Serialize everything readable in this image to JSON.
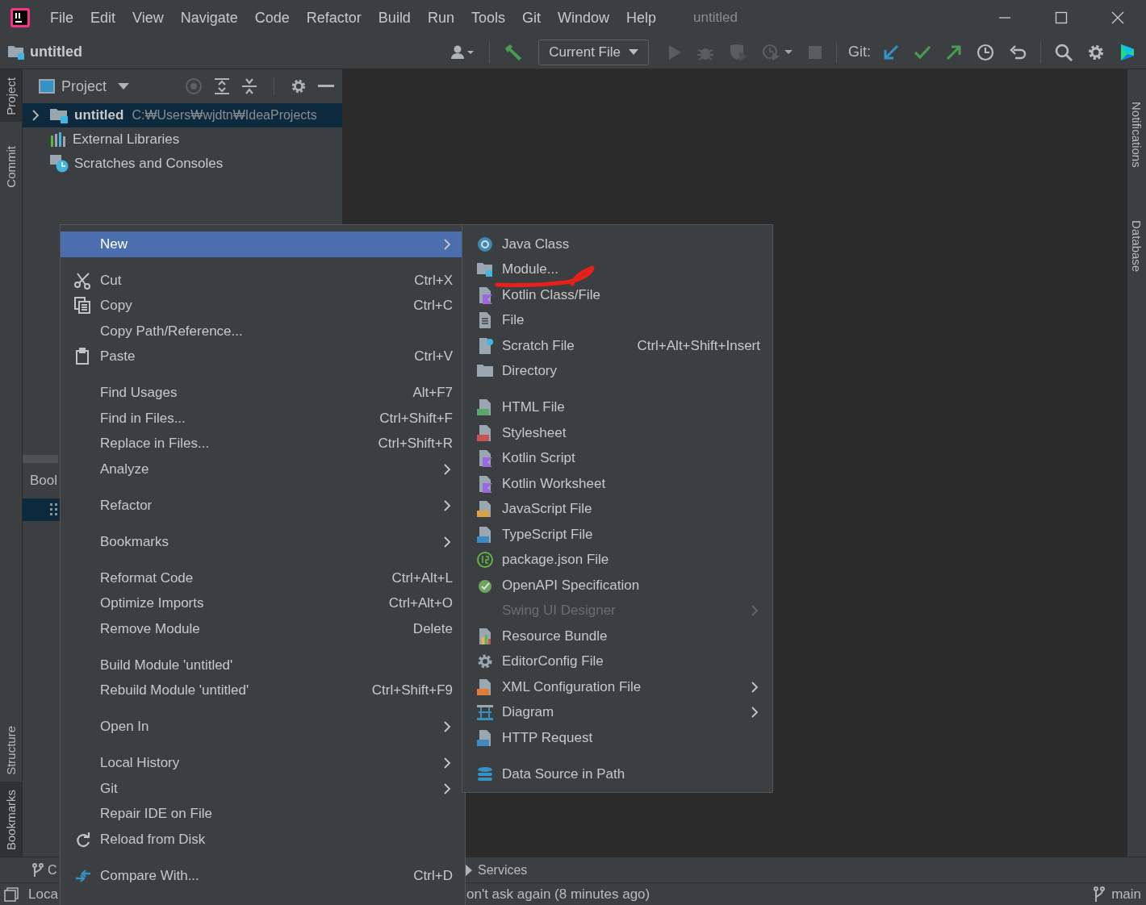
{
  "title_bar": {
    "menus": [
      {
        "label": "File"
      },
      {
        "label": "Edit"
      },
      {
        "label": "View"
      },
      {
        "label": "Navigate"
      },
      {
        "label": "Code"
      },
      {
        "label": "Refactor"
      },
      {
        "label": "Build"
      },
      {
        "label": "Run"
      },
      {
        "label": "Tools"
      },
      {
        "label": "Git"
      },
      {
        "label": "Window"
      },
      {
        "label": "Help"
      }
    ],
    "title": "untitled"
  },
  "toolbar": {
    "project": "untitled",
    "run_config": "Current File",
    "git_label": "Git:"
  },
  "left_stripe": {
    "top": [
      {
        "label": "Project",
        "selected": true
      },
      {
        "label": "Commit",
        "selected": false
      }
    ],
    "bottom": [
      {
        "label": "Structure",
        "selected": false
      },
      {
        "label": "Bookmarks",
        "selected": true
      }
    ]
  },
  "right_stripe": [
    {
      "label": "Notifications"
    },
    {
      "label": "Database"
    }
  ],
  "project_panel": {
    "title": "Project",
    "tree": [
      {
        "label": "untitled",
        "path": "C:₩Users₩wjdtn₩IdeaProjects",
        "expanded": false,
        "selected": true
      },
      {
        "label": "External Libraries",
        "selected": false
      },
      {
        "label": "Scratches and Consoles",
        "selected": false
      }
    ]
  },
  "bookmarks_panel": {
    "title": "Bool",
    "rows": [
      {
        "selected": true
      }
    ]
  },
  "bottom_bar": {
    "tabs": [
      {
        "label": "C"
      },
      {
        "label": "Services"
      }
    ]
  },
  "status_bar": {
    "left": "Loca",
    "message": "on't ask again (8 minutes ago)",
    "branch": "main"
  },
  "context_menu": {
    "items": [
      {
        "kind": "item",
        "label": "New",
        "submenu": true,
        "selected": true
      },
      {
        "kind": "separator"
      },
      {
        "kind": "item",
        "label": "Cut",
        "shortcut": "Ctrl+X",
        "selected": false
      },
      {
        "kind": "item",
        "label": "Copy",
        "shortcut": "Ctrl+C",
        "selected": false
      },
      {
        "kind": "item",
        "label": "Copy Path/Reference...",
        "selected": false
      },
      {
        "kind": "item",
        "label": "Paste",
        "shortcut": "Ctrl+V",
        "selected": false
      },
      {
        "kind": "separator"
      },
      {
        "kind": "item",
        "label": "Find Usages",
        "shortcut": "Alt+F7",
        "selected": false
      },
      {
        "kind": "item",
        "label": "Find in Files...",
        "shortcut": "Ctrl+Shift+F",
        "selected": false
      },
      {
        "kind": "item",
        "label": "Replace in Files...",
        "shortcut": "Ctrl+Shift+R",
        "selected": false
      },
      {
        "kind": "item",
        "label": "Analyze",
        "submenu": true,
        "selected": false
      },
      {
        "kind": "separator"
      },
      {
        "kind": "item",
        "label": "Refactor",
        "submenu": true,
        "selected": false
      },
      {
        "kind": "separator"
      },
      {
        "kind": "item",
        "label": "Bookmarks",
        "submenu": true,
        "selected": false
      },
      {
        "kind": "separator"
      },
      {
        "kind": "item",
        "label": "Reformat Code",
        "shortcut": "Ctrl+Alt+L",
        "selected": false
      },
      {
        "kind": "item",
        "label": "Optimize Imports",
        "shortcut": "Ctrl+Alt+O",
        "selected": false
      },
      {
        "kind": "item",
        "label": "Remove Module",
        "shortcut": "Delete",
        "selected": false
      },
      {
        "kind": "separator"
      },
      {
        "kind": "item",
        "label": "Build Module 'untitled'",
        "selected": false
      },
      {
        "kind": "item",
        "label": "Rebuild Module 'untitled'",
        "shortcut": "Ctrl+Shift+F9",
        "selected": false
      },
      {
        "kind": "separator"
      },
      {
        "kind": "item",
        "label": "Open In",
        "submenu": true,
        "selected": false
      },
      {
        "kind": "separator"
      },
      {
        "kind": "item",
        "label": "Local History",
        "submenu": true,
        "selected": false
      },
      {
        "kind": "item",
        "label": "Git",
        "submenu": true,
        "selected": false
      },
      {
        "kind": "item",
        "label": "Repair IDE on File",
        "selected": false
      },
      {
        "kind": "item",
        "label": "Reload from Disk",
        "selected": false
      },
      {
        "kind": "separator"
      },
      {
        "kind": "item",
        "label": "Compare With...",
        "shortcut": "Ctrl+D",
        "selected": false
      },
      {
        "kind": "separator"
      }
    ]
  },
  "submenu": {
    "items": [
      {
        "kind": "item",
        "label": "Java Class",
        "disabled": false
      },
      {
        "kind": "item",
        "label": "Module...",
        "disabled": false
      },
      {
        "kind": "item",
        "label": "Kotlin Class/File",
        "disabled": false
      },
      {
        "kind": "item",
        "label": "File",
        "disabled": false
      },
      {
        "kind": "item",
        "label": "Scratch File",
        "shortcut": "Ctrl+Alt+Shift+Insert",
        "disabled": false
      },
      {
        "kind": "item",
        "label": "Directory",
        "disabled": false
      },
      {
        "kind": "separator"
      },
      {
        "kind": "item",
        "label": "HTML File",
        "disabled": false
      },
      {
        "kind": "item",
        "label": "Stylesheet",
        "disabled": false
      },
      {
        "kind": "item",
        "label": "Kotlin Script",
        "disabled": false
      },
      {
        "kind": "item",
        "label": "Kotlin Worksheet",
        "disabled": false
      },
      {
        "kind": "item",
        "label": "JavaScript File",
        "disabled": false
      },
      {
        "kind": "item",
        "label": "TypeScript File",
        "disabled": false
      },
      {
        "kind": "item",
        "label": "package.json File",
        "disabled": false
      },
      {
        "kind": "item",
        "label": "OpenAPI Specification",
        "disabled": false
      },
      {
        "kind": "item",
        "label": "Swing UI Designer",
        "submenu": true,
        "disabled": true
      },
      {
        "kind": "item",
        "label": "Resource Bundle",
        "disabled": false
      },
      {
        "kind": "item",
        "label": "EditorConfig File",
        "disabled": false
      },
      {
        "kind": "item",
        "label": "XML Configuration File",
        "submenu": true,
        "disabled": false
      },
      {
        "kind": "item",
        "label": "Diagram",
        "submenu": true,
        "disabled": false
      },
      {
        "kind": "item",
        "label": "HTTP Request",
        "disabled": false
      },
      {
        "kind": "separator"
      },
      {
        "kind": "item",
        "label": "Data Source in Path",
        "disabled": false
      }
    ]
  }
}
